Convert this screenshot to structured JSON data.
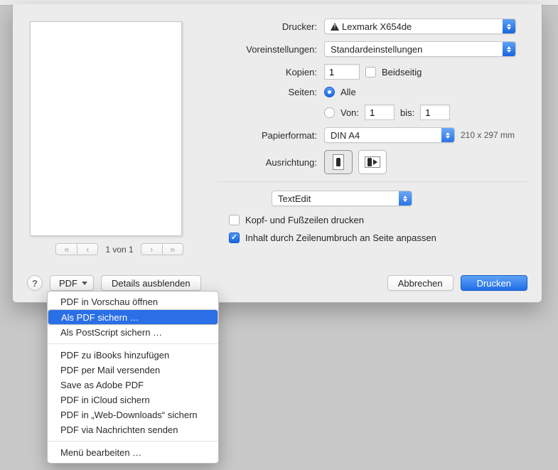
{
  "labels": {
    "printer": "Drucker:",
    "presets": "Voreinstellungen:",
    "copies": "Kopien:",
    "two_sided": "Beidseitig",
    "pages": "Seiten:",
    "all": "Alle",
    "from": "Von:",
    "to": "bis:",
    "paper_size": "Papierformat:",
    "orientation": "Ausrichtung:",
    "header_footer": "Kopf- und Fußzeilen drucken",
    "rewrap": "Inhalt durch Zeilenumbruch an Seite anpassen"
  },
  "values": {
    "printer_name": "Lexmark X654de",
    "preset_name": "Standardeinstellungen",
    "copies": "1",
    "pages_mode": "all",
    "from": "1",
    "to": "1",
    "paper_size": "DIN A4",
    "paper_dims": "210 x 297 mm",
    "section": "TextEdit",
    "header_footer_checked": false,
    "rewrap_checked": true,
    "pager_label": "1 von 1"
  },
  "footer": {
    "pdf": "PDF",
    "hide_details": "Details ausblenden",
    "cancel": "Abbrechen",
    "print": "Drucken"
  },
  "pdf_menu": {
    "open_preview": "PDF in Vorschau öffnen",
    "save_as_pdf": "Als PDF sichern …",
    "save_as_ps": "Als PostScript sichern …",
    "ibooks": "PDF zu iBooks hinzufügen",
    "mail": "PDF per Mail versenden",
    "adobe": "Save as Adobe PDF",
    "icloud": "PDF in iCloud sichern",
    "webdl": "PDF in „Web-Downloads“ sichern",
    "messages": "PDF via Nachrichten senden",
    "edit_menu": "Menü bearbeiten …"
  }
}
